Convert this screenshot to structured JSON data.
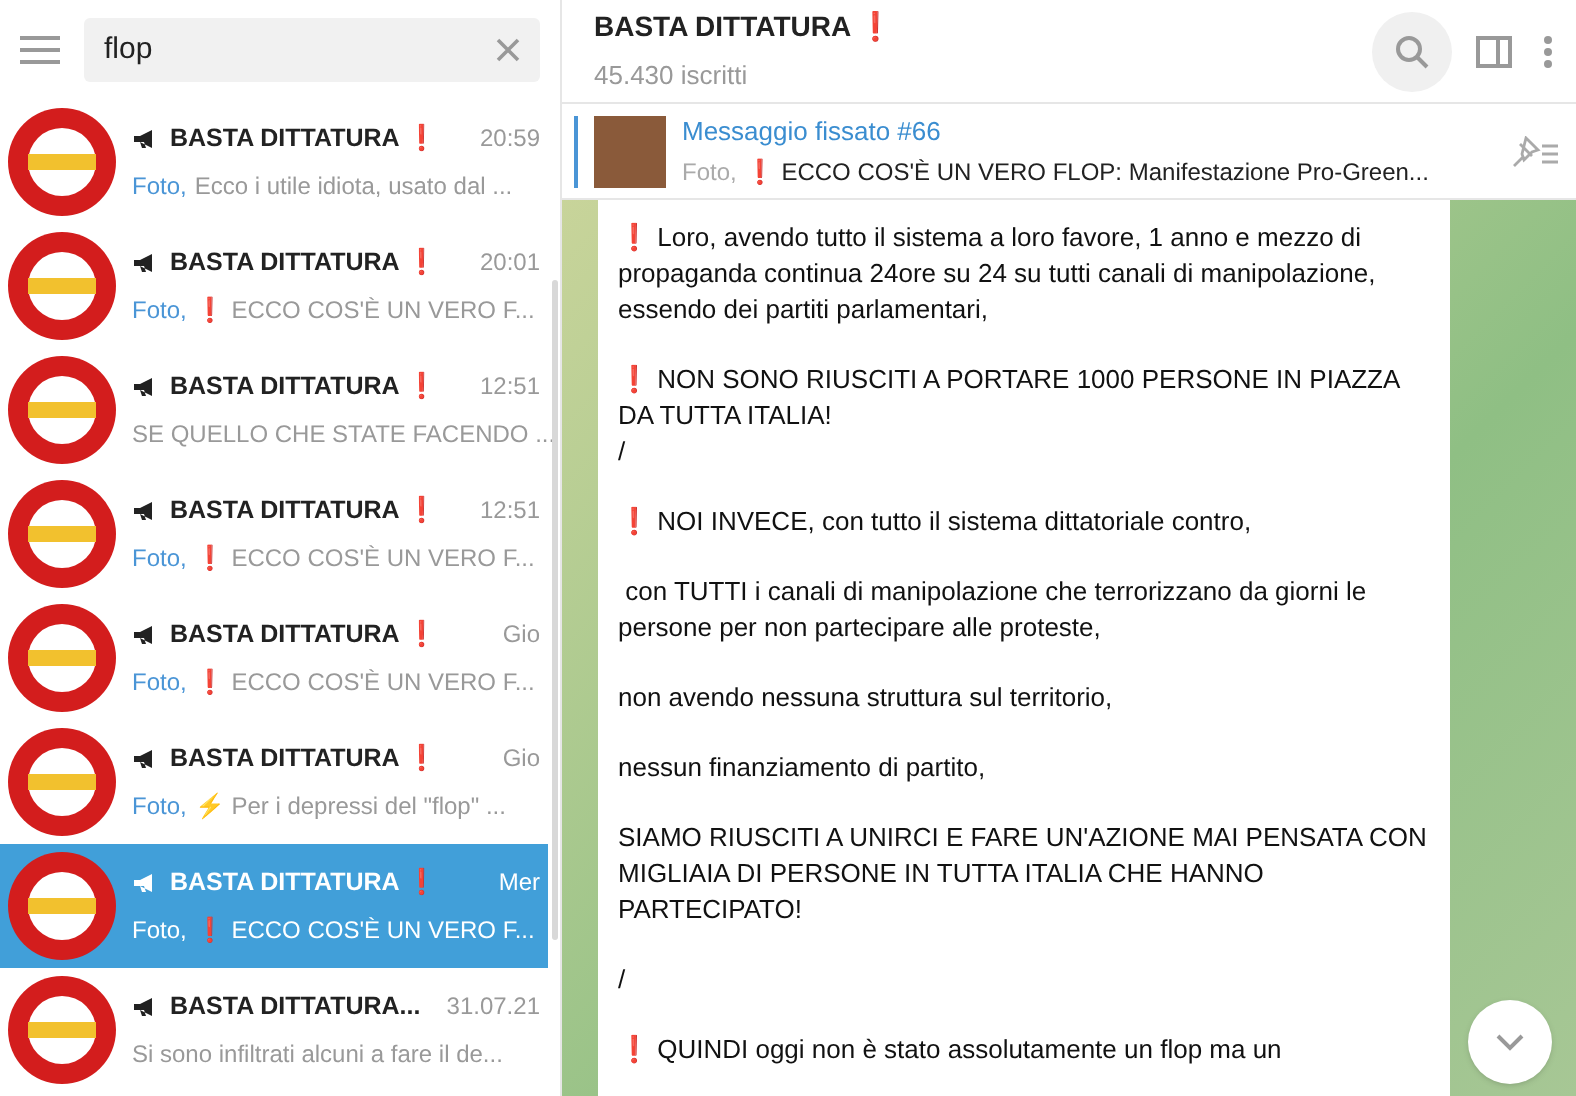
{
  "search": {
    "value": "flop"
  },
  "chats": [
    {
      "name": "BASTA DITTATURA ❗",
      "time": "20:59",
      "media": "Foto,",
      "preview": "Ecco i utile idiota, usato dal ...",
      "selected": false
    },
    {
      "name": "BASTA DITTATURA ❗",
      "time": "20:01",
      "media": "Foto,",
      "preview": "❗ ECCO COS'È UN VERO F...",
      "selected": false
    },
    {
      "name": "BASTA DITTATURA ❗",
      "time": "12:51",
      "preview": "SE QUELLO CHE STATE FACENDO ...",
      "selected": false
    },
    {
      "name": "BASTA DITTATURA ❗",
      "time": "12:51",
      "media": "Foto,",
      "preview": "❗ ECCO COS'È UN VERO F...",
      "selected": false
    },
    {
      "name": "BASTA DITTATURA ❗",
      "time": "Gio",
      "media": "Foto,",
      "preview": "❗ ECCO COS'È UN VERO F...",
      "selected": false
    },
    {
      "name": "BASTA DITTATURA ❗",
      "time": "Gio",
      "media": "Foto,",
      "preview": "⚡ Per i depressi del \"flop\" ...",
      "selected": false
    },
    {
      "name": "BASTA DITTATURA ❗",
      "time": "Mer",
      "media": "Foto,",
      "preview": "❗ ECCO COS'È UN VERO F...",
      "selected": true
    },
    {
      "name": "BASTA DITTATURA...",
      "time": "31.07.21",
      "preview": "Si sono infiltrati alcuni a fare il de...",
      "selected": false
    }
  ],
  "header": {
    "title": "BASTA DITTATURA ❗",
    "subtitle": "45.430 iscritti"
  },
  "pinned": {
    "title": "Messaggio fissato #66",
    "media": "Foto,",
    "text": "❗ ECCO COS'È UN VERO FLOP:  Manifestazione Pro-Green..."
  },
  "message": {
    "paragraphs": [
      "❗ Loro, avendo tutto il sistema a loro favore, 1 anno e mezzo di propaganda continua 24ore su 24 su tutti canali di manipolazione, essendo dei partiti parlamentari,",
      "❗ NON SONO RIUSCITI A PORTARE 1000 PERSONE IN PIAZZA DA TUTTA ITALIA!\n/",
      "❗ NOI INVECE, con tutto il sistema dittatoriale contro,",
      " con TUTTI i canali di manipolazione che terrorizzano da giorni le persone per non partecipare alle proteste,",
      "non avendo nessuna struttura sul territorio,",
      "nessun finanziamento di partito,",
      "SIAMO RIUSCITI A UNIRCI E FARE UN'AZIONE MAI PENSATA CON MIGLIAIA DI PERSONE IN TUTTA ITALIA CHE HANNO PARTECIPATO!",
      "/",
      "❗ QUINDI oggi non è stato assolutamente un flop ma un"
    ]
  }
}
